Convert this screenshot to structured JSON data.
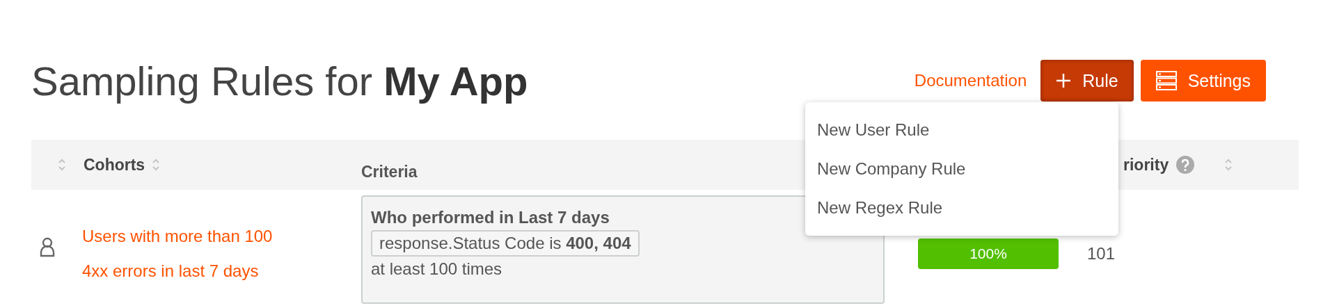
{
  "header": {
    "title": "Sampling Rules for **My App**",
    "documentation_link": "Documentation",
    "add_rule_button": {
      "label": "Rule",
      "selected": true
    },
    "settings_button": "Settings"
  },
  "rule_menu": {
    "items": [
      "New User Rule",
      "New Company Rule",
      "New Regex Rule"
    ]
  },
  "table": {
    "columns": [
      {
        "label": "Cohorts"
      },
      {
        "label": "Criteria"
      },
      {
        "label": "riority"
      }
    ],
    "rows": [
      {
        "cohort": "Users with more than 100 4xx errors in last 7 days",
        "criteria": {
          "title": "Who performed in Last 7 days",
          "condition": "response.Status Code is **400, 404**",
          "frequency": "at least 100 times"
        },
        "sample_rate": {
          "level": 1,
          "label": "100%"
        },
        "priority": "101"
      }
    ]
  }
}
